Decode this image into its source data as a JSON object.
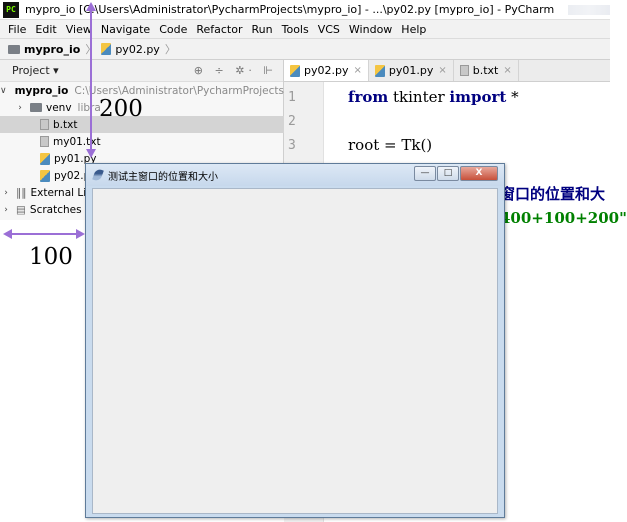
{
  "window": {
    "app_icon_text": "PC",
    "title": "mypro_io [C:\\Users\\Administrator\\PycharmProjects\\mypro_io] - ...\\py02.py [mypro_io] - PyCharm"
  },
  "menu": [
    "File",
    "Edit",
    "View",
    "Navigate",
    "Code",
    "Refactor",
    "Run",
    "Tools",
    "VCS",
    "Window",
    "Help"
  ],
  "breadcrumb": {
    "project": "mypro_io",
    "file": "py02.py",
    "separator": "〉"
  },
  "project_panel": {
    "title": "Project ▾",
    "toolbar": "⊕ ÷ ✲· ⊩",
    "tree": [
      {
        "arrow": "∨",
        "label": "mypro_io",
        "path": "C:\\Users\\Administrator\\PycharmProjects\\r"
      },
      {
        "arrow": "›",
        "label": "venv",
        "path": "libra"
      },
      {
        "label": "b.txt"
      },
      {
        "label": "my01.txt"
      },
      {
        "label": "py01.py"
      },
      {
        "label": "py02.py"
      },
      {
        "arrow": "›",
        "label": "External Li"
      },
      {
        "arrow": "›",
        "label": "Scratches"
      }
    ]
  },
  "editor": {
    "tabs": [
      {
        "label": "py02.py",
        "close": "×"
      },
      {
        "label": "py01.py",
        "close": "×"
      },
      {
        "label": "b.txt",
        "close": "×"
      }
    ],
    "line_numbers": [
      "1",
      "2",
      "3"
    ],
    "code": {
      "line1_kw1": "from",
      "line1_mid": " tkinter ",
      "line1_kw2": "import",
      "line1_end": " *",
      "line3": "root = Tk()"
    },
    "overflow_line1": "窗口的位置和大",
    "overflow_line2": "400+100+200\""
  },
  "tk_window": {
    "title": "测试主窗口的位置和大小",
    "minimize": "—",
    "maximize": "□",
    "close": "X"
  },
  "annotations": {
    "offset_y": "200",
    "offset_x": "100"
  },
  "colors": {
    "annotation_arrow": "#9b6fd6",
    "keyword": "#000080",
    "string": "#008000"
  }
}
